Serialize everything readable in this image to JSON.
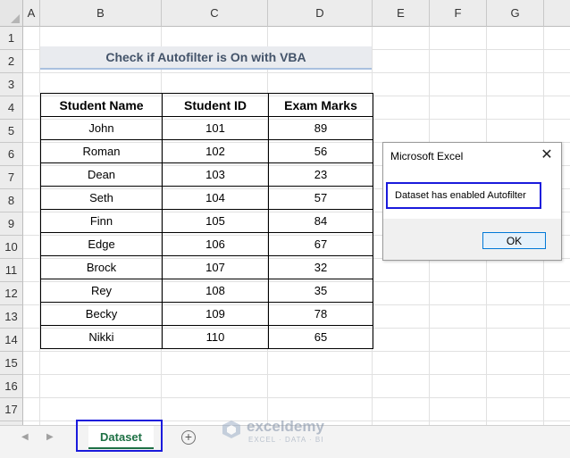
{
  "columns": [
    "A",
    "B",
    "C",
    "D",
    "E",
    "F",
    "G"
  ],
  "rows": [
    "1",
    "2",
    "3",
    "4",
    "5",
    "6",
    "7",
    "8",
    "9",
    "10",
    "11",
    "12",
    "13",
    "14",
    "15",
    "16",
    "17"
  ],
  "title": "Check if Autofilter is On with VBA",
  "table": {
    "headers": [
      "Student Name",
      "Student ID",
      "Exam Marks"
    ],
    "rows": [
      [
        "John",
        "101",
        "89"
      ],
      [
        "Roman",
        "102",
        "56"
      ],
      [
        "Dean",
        "103",
        "23"
      ],
      [
        "Seth",
        "104",
        "57"
      ],
      [
        "Finn",
        "105",
        "84"
      ],
      [
        "Edge",
        "106",
        "67"
      ],
      [
        "Brock",
        "107",
        "32"
      ],
      [
        "Rey",
        "108",
        "35"
      ],
      [
        "Becky",
        "109",
        "78"
      ],
      [
        "Nikki",
        "110",
        "65"
      ]
    ]
  },
  "dialog": {
    "title": "Microsoft Excel",
    "message": "Dataset has enabled Autofilter",
    "ok_label": "OK",
    "close_glyph": "✕"
  },
  "tabs": {
    "active": "Dataset",
    "add_glyph": "+",
    "prev_glyph": "◀",
    "next_glyph": "▶"
  },
  "watermark": {
    "name": "exceldemy",
    "tagline": "EXCEL · DATA · BI"
  },
  "colors": {
    "sheet_tab_green": "#1e7145",
    "highlight_blue": "#1a1adc",
    "title_fill": "#e9ebef"
  }
}
